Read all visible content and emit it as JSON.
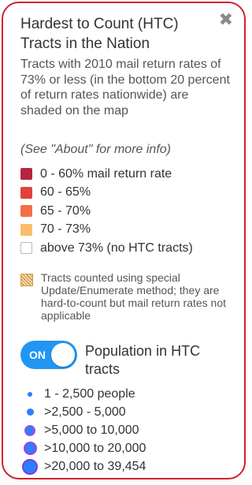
{
  "panel": {
    "title": "Hardest to Count (HTC) Tracts in the Nation",
    "description": "Tracts with 2010 mail return rates of 73% or less (in the bottom 20 percent of return rates nationwide) are shaded on the map",
    "about_note": "(See \"About\" for more info)"
  },
  "legend": [
    {
      "label": "0 - 60% mail return rate",
      "color": "#b5243f"
    },
    {
      "label": "60 - 65%",
      "color": "#e3413b"
    },
    {
      "label": "65 - 70%",
      "color": "#f36f49"
    },
    {
      "label": "70 - 73%",
      "color": "#f9bd6b"
    },
    {
      "label": "above 73% (no HTC tracts)",
      "color": "#ffffff"
    }
  ],
  "special": {
    "text": "Tracts counted using special Update/Enumerate method; they are hard-to-count but mail return rates not applicable"
  },
  "toggle": {
    "state": "ON",
    "label": "Population in HTC tracts",
    "color": "#2196f3"
  },
  "population_legend": [
    {
      "label": "1 - 2,500 people"
    },
    {
      "label": ">2,500 - 5,000"
    },
    {
      "label": ">5,000 to 10,000"
    },
    {
      "label": ">10,000 to 20,000"
    },
    {
      "label": ">20,000 to 39,454"
    }
  ],
  "icons": {
    "close": "close-icon"
  }
}
